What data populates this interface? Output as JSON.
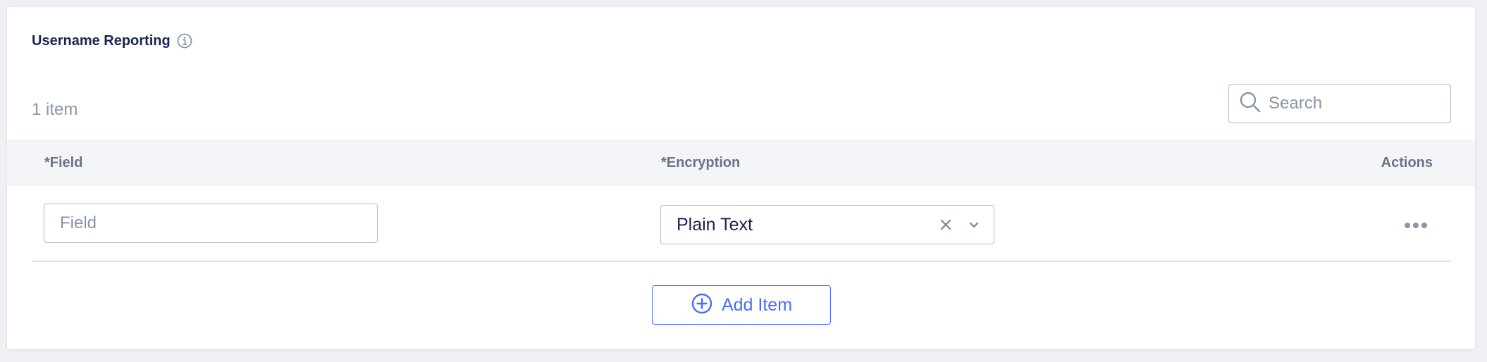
{
  "section": {
    "title": "Username Reporting",
    "info_icon": "info-icon"
  },
  "toolbar": {
    "item_count": "1 item",
    "search_placeholder": "Search",
    "search_icon": "search-icon"
  },
  "table": {
    "columns": [
      "*Field",
      "*Encryption",
      "Actions"
    ],
    "rows": [
      {
        "field_placeholder": "Field",
        "field_value": "",
        "encryption": "Plain Text",
        "clear_icon": "close-icon",
        "dropdown_icon": "chevron-down-icon",
        "actions_icon": "more-horizontal-icon"
      }
    ]
  },
  "add_button": {
    "label": "Add Item",
    "icon": "plus-circle-icon"
  },
  "colors": {
    "title": "#1b2450",
    "muted": "#8a93a8",
    "accent": "#4a6cf7",
    "header_bg": "#f4f5f8",
    "border": "#b4bac6"
  }
}
